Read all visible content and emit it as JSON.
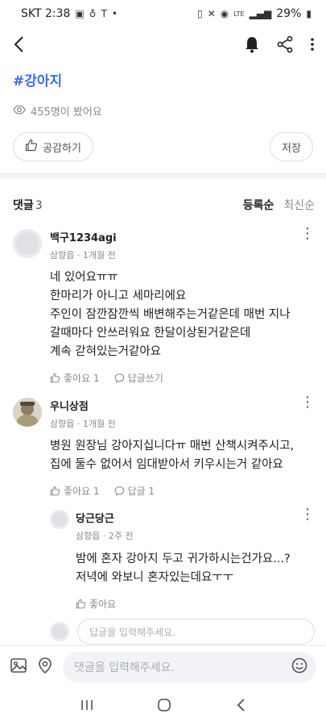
{
  "status_bar": {
    "carrier_time": "SKT 2:38",
    "network": "LTE",
    "battery": "29%"
  },
  "post": {
    "hashtag": "#강아지",
    "views": "455명이 봤어요"
  },
  "actions": {
    "like_label": "공감하기",
    "save_label": "저장"
  },
  "comments_section": {
    "title": "댓글",
    "count": "3",
    "sort_options": [
      "등록순",
      "최신순"
    ]
  },
  "comments": [
    {
      "author": "백구1234agi",
      "meta": "삼향읍 · 1개월 전",
      "lines": [
        "네 있어요ㅠㅠ",
        "한마리가 아니고 세마리에요",
        "주인이 잠깐잠깐씩 배변해주는거같은데 매번 지나",
        "갈때마다 안쓰러워요 한달이상된거같은데",
        "계속 갇혀있는거같아요"
      ],
      "like_label": "좋아요 1",
      "reply_label": "답글쓰기"
    },
    {
      "author": "우니상점",
      "meta": "삼향읍 · 1개월 전",
      "lines": [
        "병원 원장님 강아지십니다ㅠ 매번 산책시켜주시고,",
        "집에 둘수 없어서 임대받아서 키우시는거 같아요"
      ],
      "like_label": "좋아요 1",
      "reply_label": "답글 1"
    }
  ],
  "reply": {
    "author": "당근당근",
    "meta": "삼향읍 · 2주 전",
    "lines": [
      "밤에 혼자 강아지 두고 귀가하시는건가요...?",
      "저녁에 와보니 혼자있는데요ㅜㅜ"
    ],
    "like_label": "좋아요"
  },
  "reply_input": {
    "placeholder": "답글을 입력해주세요."
  },
  "bottom_input": {
    "placeholder": "댓글을 입력해주세요."
  }
}
